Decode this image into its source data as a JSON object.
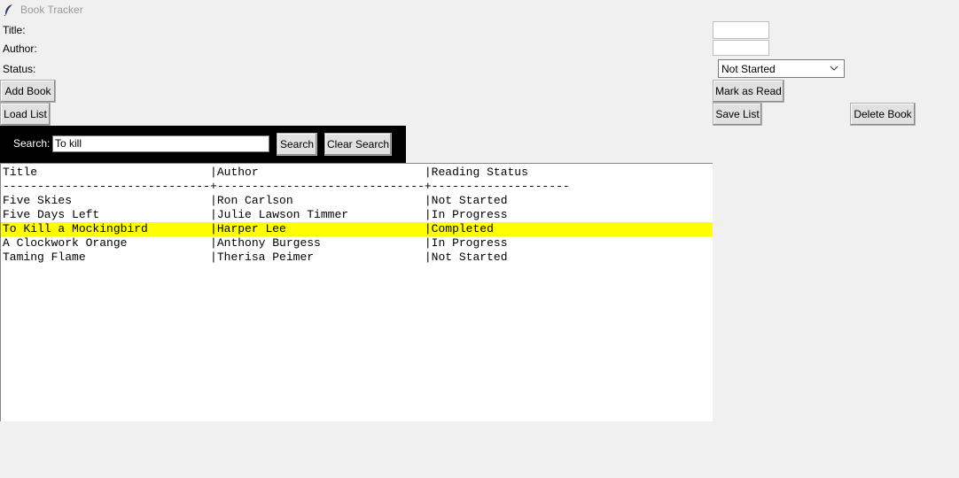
{
  "window": {
    "title": "Book Tracker"
  },
  "form": {
    "title_label": "Title:",
    "author_label": "Author:",
    "status_label": "Status:",
    "title_value": "",
    "author_value": "",
    "status_selected": "Not Started"
  },
  "buttons": {
    "add_book": "Add Book",
    "mark_as_read": "Mark as Read",
    "load_list": "Load List",
    "save_list": "Save List",
    "delete_book": "Delete Book"
  },
  "search": {
    "label": "Search:",
    "value": "To kill",
    "search_button": "Search",
    "clear_button": "Clear Search"
  },
  "list": {
    "header": "Title                         |Author                        |Reading Status",
    "separator": "------------------------------+------------------------------+--------------------",
    "rows": [
      {
        "text": "Five Skies                    |Ron Carlson                   |Not Started",
        "highlighted": false
      },
      {
        "text": "Five Days Left                |Julie Lawson Timmer           |In Progress",
        "highlighted": false
      },
      {
        "text": "To Kill a Mockingbird         |Harper Lee                    |Completed",
        "highlighted": true
      },
      {
        "text": "A Clockwork Orange            |Anthony Burgess               |In Progress",
        "highlighted": false
      },
      {
        "text": "Taming Flame                  |Therisa Peimer                |Not Started",
        "highlighted": false
      }
    ],
    "highlight_color": "#ffff00"
  }
}
